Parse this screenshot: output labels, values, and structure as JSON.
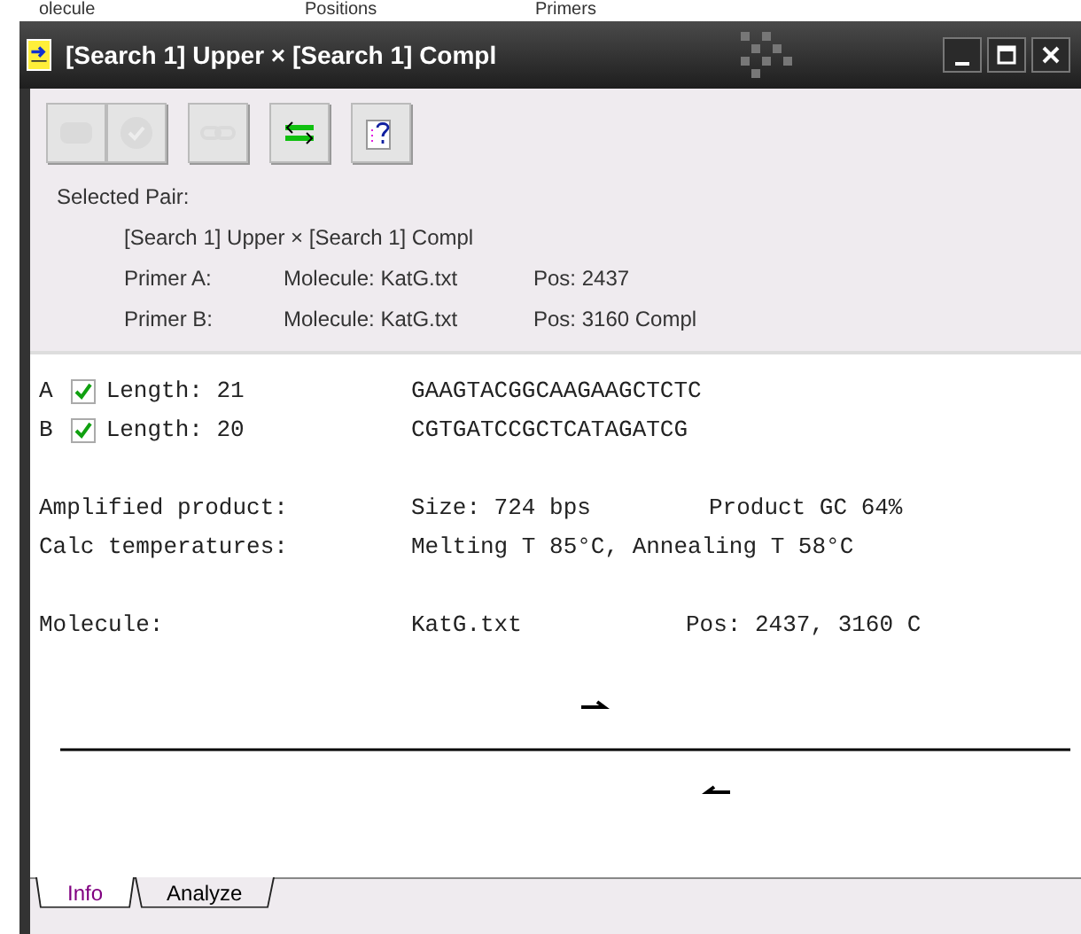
{
  "background_headers": [
    "olecule",
    "Positions",
    "Primers"
  ],
  "window": {
    "title": "[Search 1] Upper × [Search 1] Compl"
  },
  "toolbar": [
    {
      "kind": "note",
      "disabled": true
    },
    {
      "kind": "check",
      "disabled": true
    },
    {
      "kind": "link",
      "disabled": true
    },
    {
      "kind": "swap",
      "disabled": false
    },
    {
      "kind": "help",
      "disabled": false
    }
  ],
  "selected_pair": {
    "heading": "Selected Pair:",
    "pair": "[Search 1] Upper × [Search 1] Compl",
    "primers": [
      {
        "label": "Primer A:",
        "molecule": "Molecule: KatG.txt",
        "pos": "Pos: 2437"
      },
      {
        "label": "Primer B:",
        "molecule": "Molecule: KatG.txt",
        "pos": "Pos: 3160 Compl"
      }
    ]
  },
  "primers": [
    {
      "name": "A",
      "checked": true,
      "length": "Length: 21",
      "sequence": "GAAGTACGGCAAGAAGCTCTC"
    },
    {
      "name": "B",
      "checked": true,
      "length": "Length: 20",
      "sequence": "CGTGATCCGCTCATAGATCG"
    }
  ],
  "product": {
    "label": "Amplified product:",
    "size": "Size: 724 bps",
    "gc": "Product GC 64%"
  },
  "temperatures": {
    "label": "Calc temperatures:",
    "value": "Melting T 85°C, Annealing T 58°C"
  },
  "molecule": {
    "label": "Molecule:",
    "file": "KatG.txt",
    "pos": "Pos: 2437, 3160 C"
  },
  "tabs": [
    {
      "label": "Info",
      "selected": true
    },
    {
      "label": "Analyze",
      "selected": false
    }
  ]
}
